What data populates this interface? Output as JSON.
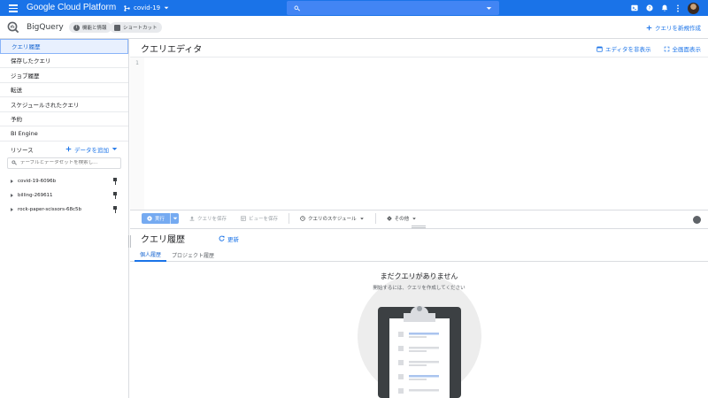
{
  "topbar": {
    "brand": "Google Cloud Platform",
    "project": "covid-19",
    "colors": {
      "bar": "#1a73e8",
      "search": "#4285f4"
    }
  },
  "header": {
    "product": "BigQuery",
    "chip_features": "機能と情報",
    "chip_shortcuts": "ショートカット",
    "compose": "クエリを新規作成"
  },
  "sidebar": {
    "items": [
      {
        "label": "クエリ履歴",
        "active": true
      },
      {
        "label": "保存したクエリ"
      },
      {
        "label": "ジョブ履歴"
      },
      {
        "label": "転送"
      },
      {
        "label": "スケジュールされたクエリ"
      },
      {
        "label": "予約"
      },
      {
        "label": "BI Engine"
      }
    ],
    "resources_label": "リソース",
    "add_data": "データを追加",
    "search_placeholder": "テーブルとデータセットを検索し...",
    "projects": [
      {
        "name": "covid-19-6096b"
      },
      {
        "name": "billing-269611"
      },
      {
        "name": "rock-paper-scissors-68c5b"
      }
    ]
  },
  "editor": {
    "title": "クエリエディタ",
    "hide_editor": "エディタを非表示",
    "fullscreen": "全画面表示",
    "line_number": "1"
  },
  "toolbar": {
    "run": "実行",
    "save_query": "クエリを保存",
    "save_view": "ビューを保存",
    "schedule": "クエリのスケジュール",
    "more": "その他"
  },
  "history": {
    "title": "クエリ履歴",
    "refresh": "更新",
    "tabs": [
      {
        "label": "個人履歴",
        "active": true
      },
      {
        "label": "プロジェクト履歴"
      }
    ],
    "empty_title": "まだクエリがありません",
    "empty_subtitle": "開始するには、クエリを作成してください"
  }
}
